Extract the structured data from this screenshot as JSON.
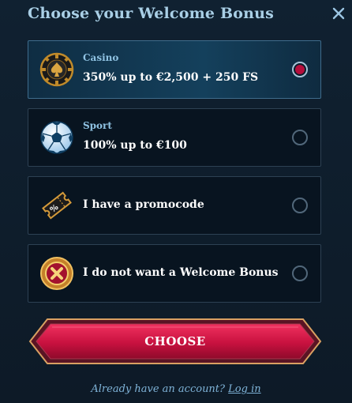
{
  "modal": {
    "title": "Choose your Welcome Bonus",
    "close_icon": "close-icon"
  },
  "options": [
    {
      "sub": "Casino",
      "label": "350% up to €2,500 + 250 FS",
      "icon": "poker-chip-spade-icon",
      "selected": true
    },
    {
      "sub": "Sport",
      "label": "100% up to €100",
      "icon": "soccer-ball-icon",
      "selected": false
    },
    {
      "sub": "",
      "label": "I have a promocode",
      "icon": "promo-ticket-icon",
      "selected": false
    },
    {
      "sub": "",
      "label": "I do not want a Welcome Bonus",
      "icon": "cancel-x-badge-icon",
      "selected": false
    }
  ],
  "cta": {
    "label": "CHOOSE"
  },
  "footer": {
    "text": "Already have an account?",
    "link": "Log in"
  },
  "colors": {
    "accent": "#b50e3c",
    "title": "#a9cfe6",
    "link": "#7fb3d8"
  }
}
